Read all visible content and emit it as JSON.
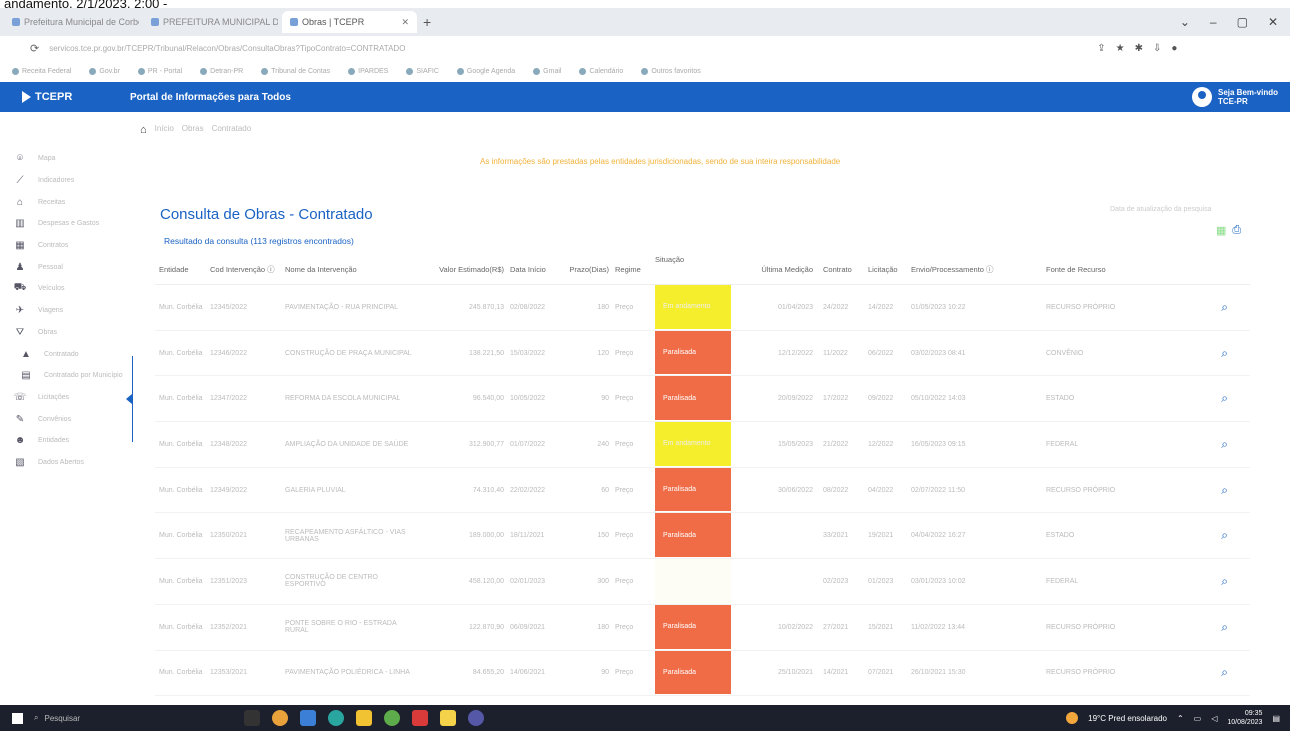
{
  "top_clip_text": "andamento, 2/1/2023, 2:00 -",
  "browser": {
    "tabs": [
      {
        "title": "Prefeitura Municipal de Corbélia",
        "active": false
      },
      {
        "title": "PREFEITURA MUNICIPAL DE CO",
        "active": false
      },
      {
        "title": "Obras | TCEPR",
        "active": true
      }
    ],
    "url": "servicos.tce.pr.gov.br/TCEPR/Tribunal/Relacon/Obras/ConsultaObras?TipoContrato=CONTRATADO",
    "bookmarks": [
      "Receita Federal",
      "Gov.br",
      "PR - Portal",
      "Detran-PR",
      "Tribunal de Contas",
      "IPARDES",
      "SIAFIC",
      "Google Agenda",
      "Gmail",
      "Calendário",
      "Outros favoritos"
    ]
  },
  "header": {
    "logo": "TCEPR",
    "portal_title": "Portal de Informações para Todos",
    "user_greeting": "Seja Bem-vindo",
    "user_org": "TCE-PR"
  },
  "breadcrumb": [
    "Início",
    "Obras",
    "Contratado"
  ],
  "sidebar": {
    "items": [
      {
        "icon": "map-pin-icon",
        "glyph": "⌾",
        "label": "Mapa",
        "sub": false
      },
      {
        "icon": "trend-icon",
        "glyph": "⟋",
        "label": "Indicadores",
        "sub": false
      },
      {
        "icon": "bank-icon",
        "glyph": "⌂",
        "label": "Receitas",
        "sub": false
      },
      {
        "icon": "bar-chart-icon",
        "glyph": "▥",
        "label": "Despesas e Gastos",
        "sub": false
      },
      {
        "icon": "grid-icon",
        "glyph": "▦",
        "label": "Contratos",
        "sub": false
      },
      {
        "icon": "people-icon",
        "glyph": "♟",
        "label": "Pessoal",
        "sub": false
      },
      {
        "icon": "car-icon",
        "glyph": "⛟",
        "label": "Veículos",
        "sub": false
      },
      {
        "icon": "plane-icon",
        "glyph": "✈",
        "label": "Viagens",
        "sub": false
      },
      {
        "icon": "road-icon",
        "glyph": "⛛",
        "label": "Obras",
        "sub": false
      },
      {
        "icon": "road-small-icon",
        "glyph": "▲",
        "label": "Contratado",
        "sub": true
      },
      {
        "icon": "doc-icon",
        "glyph": "▤",
        "label": "Contratado por Município",
        "sub": true
      },
      {
        "icon": "chat-icon",
        "glyph": "☏",
        "label": "Licitações",
        "sub": false
      },
      {
        "icon": "tools-icon",
        "glyph": "✎",
        "label": "Convênios",
        "sub": false
      },
      {
        "icon": "group-icon",
        "glyph": "☻",
        "label": "Entidades",
        "sub": false
      },
      {
        "icon": "table-icon",
        "glyph": "▧",
        "label": "Dados Abertos",
        "sub": false
      }
    ]
  },
  "notice": "As informações são prestadas pelas entidades jurisdicionadas, sendo de sua inteira responsabilidade",
  "page": {
    "title": "Consulta de Obras - Contratado",
    "result_count": "Resultado da consulta (113 registros encontrados)",
    "refresh_label": "Data de atualização da pesquisa"
  },
  "table": {
    "headers": [
      "Entidade",
      "Cod Intervenção ⓘ",
      "Nome da Intervenção",
      "Valor Estimado(R$)",
      "Data Início",
      "Prazo(Dias)",
      "Regime",
      "Situação",
      "Última Medição",
      "Contrato",
      "Licitação",
      "Envio/Processamento ⓘ",
      "Fonte de Recurso",
      ""
    ],
    "rows": [
      {
        "entidade": "Mun. Corbélia",
        "cod": "12345/2022",
        "nome": "PAVIMENTAÇÃO - RUA PRINCIPAL",
        "valor": "245.870,13",
        "inicio": "02/08/2022",
        "prazo": "180",
        "regime": "Preço",
        "situacao": "Em andamento",
        "sit_class": "andamento",
        "medicao": "01/04/2023",
        "contrato": "24/2022",
        "licitacao": "14/2022",
        "envio": "01/05/2023 10:22",
        "fonte": "RECURSO PRÓPRIO"
      },
      {
        "entidade": "Mun. Corbélia",
        "cod": "12346/2022",
        "nome": "CONSTRUÇÃO DE PRAÇA MUNICIPAL",
        "valor": "138.221,50",
        "inicio": "15/03/2022",
        "prazo": "120",
        "regime": "Preço",
        "situacao": "Paralisada",
        "sit_class": "paralisada",
        "medicao": "12/12/2022",
        "contrato": "11/2022",
        "licitacao": "06/2022",
        "envio": "03/02/2023 08:41",
        "fonte": "CONVÊNIO"
      },
      {
        "entidade": "Mun. Corbélia",
        "cod": "12347/2022",
        "nome": "REFORMA DA ESCOLA MUNICIPAL",
        "valor": "96.540,00",
        "inicio": "10/05/2022",
        "prazo": "90",
        "regime": "Preço",
        "situacao": "Paralisada",
        "sit_class": "paralisada",
        "medicao": "20/09/2022",
        "contrato": "17/2022",
        "licitacao": "09/2022",
        "envio": "05/10/2022 14:03",
        "fonte": "ESTADO"
      },
      {
        "entidade": "Mun. Corbélia",
        "cod": "12348/2022",
        "nome": "AMPLIAÇÃO DA UNIDADE DE SAÚDE",
        "valor": "312.900,77",
        "inicio": "01/07/2022",
        "prazo": "240",
        "regime": "Preço",
        "situacao": "Em andamento",
        "sit_class": "andamento",
        "medicao": "15/05/2023",
        "contrato": "21/2022",
        "licitacao": "12/2022",
        "envio": "16/05/2023 09:15",
        "fonte": "FEDERAL"
      },
      {
        "entidade": "Mun. Corbélia",
        "cod": "12349/2022",
        "nome": "GALERIA PLUVIAL",
        "valor": "74.310,40",
        "inicio": "22/02/2022",
        "prazo": "60",
        "regime": "Preço",
        "situacao": "Paralisada",
        "sit_class": "paralisada",
        "medicao": "30/06/2022",
        "contrato": "08/2022",
        "licitacao": "04/2022",
        "envio": "02/07/2022 11:50",
        "fonte": "RECURSO PRÓPRIO"
      },
      {
        "entidade": "Mun. Corbélia",
        "cod": "12350/2021",
        "nome": "RECAPEAMENTO ASFÁLTICO - VIAS URBANAS",
        "valor": "189.000,00",
        "inicio": "18/11/2021",
        "prazo": "150",
        "regime": "Preço",
        "situacao": "Paralisada",
        "sit_class": "paralisada",
        "medicao": "",
        "contrato": "33/2021",
        "licitacao": "19/2021",
        "envio": "04/04/2022 16:27",
        "fonte": "ESTADO"
      },
      {
        "entidade": "Mun. Corbélia",
        "cod": "12351/2023",
        "nome": "CONSTRUÇÃO DE CENTRO ESPORTIVO",
        "valor": "458.120,00",
        "inicio": "02/01/2023",
        "prazo": "300",
        "regime": "Preço",
        "situacao": "",
        "sit_class": "blank",
        "medicao": "",
        "contrato": "02/2023",
        "licitacao": "01/2023",
        "envio": "03/01/2023 10:02",
        "fonte": "FEDERAL"
      },
      {
        "entidade": "Mun. Corbélia",
        "cod": "12352/2021",
        "nome": "PONTE SOBRE O RIO - ESTRADA RURAL",
        "valor": "122.870,90",
        "inicio": "06/09/2021",
        "prazo": "180",
        "regime": "Preço",
        "situacao": "Paralisada",
        "sit_class": "paralisada",
        "medicao": "10/02/2022",
        "contrato": "27/2021",
        "licitacao": "15/2021",
        "envio": "11/02/2022 13:44",
        "fonte": "RECURSO PRÓPRIO"
      },
      {
        "entidade": "Mun. Corbélia",
        "cod": "12353/2021",
        "nome": "PAVIMENTAÇÃO POLIÉDRICA - LINHA",
        "valor": "84.655,20",
        "inicio": "14/06/2021",
        "prazo": "90",
        "regime": "Preço",
        "situacao": "Paralisada",
        "sit_class": "paralisada",
        "medicao": "25/10/2021",
        "contrato": "14/2021",
        "licitacao": "07/2021",
        "envio": "26/10/2021 15:30",
        "fonte": "RECURSO PRÓPRIO"
      }
    ]
  },
  "taskbar": {
    "search_placeholder": "Pesquisar",
    "weather": "19°C Pred ensolarado",
    "time": "09:35",
    "date": "10/08/2023"
  }
}
